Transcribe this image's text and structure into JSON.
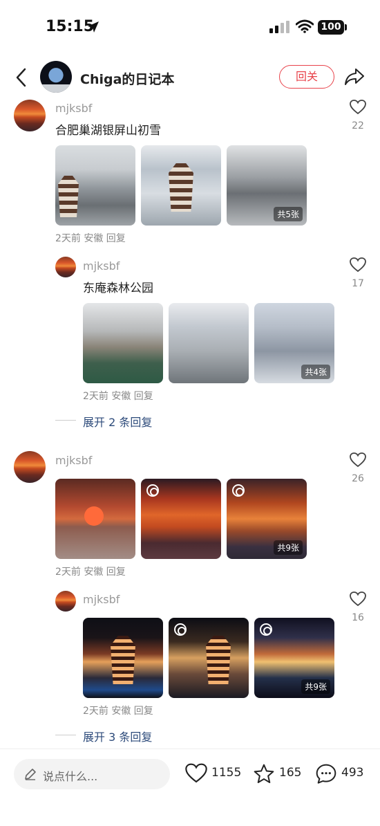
{
  "status_bar": {
    "time": "15:15",
    "battery": "100"
  },
  "header": {
    "title": "Chiga的日记本",
    "follow_label": "回关"
  },
  "comments": [
    {
      "user": "mjksbf",
      "text": "合肥巢湖银屏山初雪",
      "meta": "2天前 安徽 回复",
      "likes": "22",
      "photo_badge": "共5张"
    },
    {
      "user": "mjksbf",
      "text": "东庵森林公园",
      "meta": "2天前 安徽 回复",
      "likes": "17",
      "photo_badge": "共4张",
      "expand": "展开 2 条回复"
    },
    {
      "user": "mjksbf",
      "meta": "2天前 安徽 回复",
      "likes": "26",
      "photo_badge": "共9张"
    },
    {
      "user": "mjksbf",
      "meta": "2天前 安徽 回复",
      "likes": "16",
      "photo_badge": "共9张",
      "expand": "展开 3 条回复"
    }
  ],
  "bottom_bar": {
    "input_placeholder": "说点什么...",
    "likes": "1155",
    "favorites": "165",
    "comments": "493"
  },
  "colors": {
    "accent": "#e8424a",
    "link": "#2c4a7a"
  }
}
